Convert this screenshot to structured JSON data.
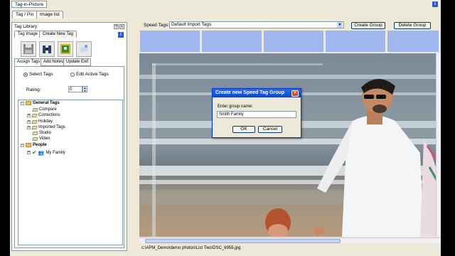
{
  "app": {
    "title": "Tag-in-Picture"
  },
  "main_tabs": [
    "Tag / Pin",
    "Image list"
  ],
  "library": {
    "header": "Tag Library",
    "tabs": [
      "Tag Image",
      "Create New Tag"
    ],
    "subtabs": [
      "Assign Tags",
      "Add Notes",
      "Update Exif"
    ],
    "radio_select": "Select Tags",
    "radio_edit": "Edit Active Tags",
    "rating_label": "Rating:",
    "rating_value": "0",
    "tree": [
      {
        "label": "General Tags",
        "level": 0,
        "type": "folder",
        "bold": true
      },
      {
        "label": "Compare",
        "level": 1,
        "type": "tag"
      },
      {
        "label": "Corrections",
        "level": 1,
        "type": "tag",
        "expandable": true
      },
      {
        "label": "Holiday",
        "level": 1,
        "type": "tag",
        "expandable": true
      },
      {
        "label": "Imported Tags",
        "level": 1,
        "type": "tag",
        "expandable": true
      },
      {
        "label": "Studio",
        "level": 1,
        "type": "tag"
      },
      {
        "label": "Video",
        "level": 1,
        "type": "tag"
      },
      {
        "label": "People",
        "level": 0,
        "type": "folder",
        "bold": true
      },
      {
        "label": "My Family",
        "level": 1,
        "type": "group",
        "checked": true,
        "expandable": true
      }
    ]
  },
  "speed": {
    "label": "Speed Tags:",
    "selected": "Default Import Tags",
    "create_group": "Create Group",
    "delete_group": "Delete Group"
  },
  "status": {
    "path": "c:\\APM_Demo\\demo photos\\List Two\\DSC_6955.jpg"
  },
  "dialog": {
    "title": "Create new Speed Tag Group",
    "label": "Enter group name:",
    "value": "Smith Family",
    "ok": "OK",
    "cancel": "Cancel"
  },
  "colors": {
    "titlebar": "#0a46c8",
    "slot": "#9fb7ee",
    "info": "#2a5bd7"
  }
}
